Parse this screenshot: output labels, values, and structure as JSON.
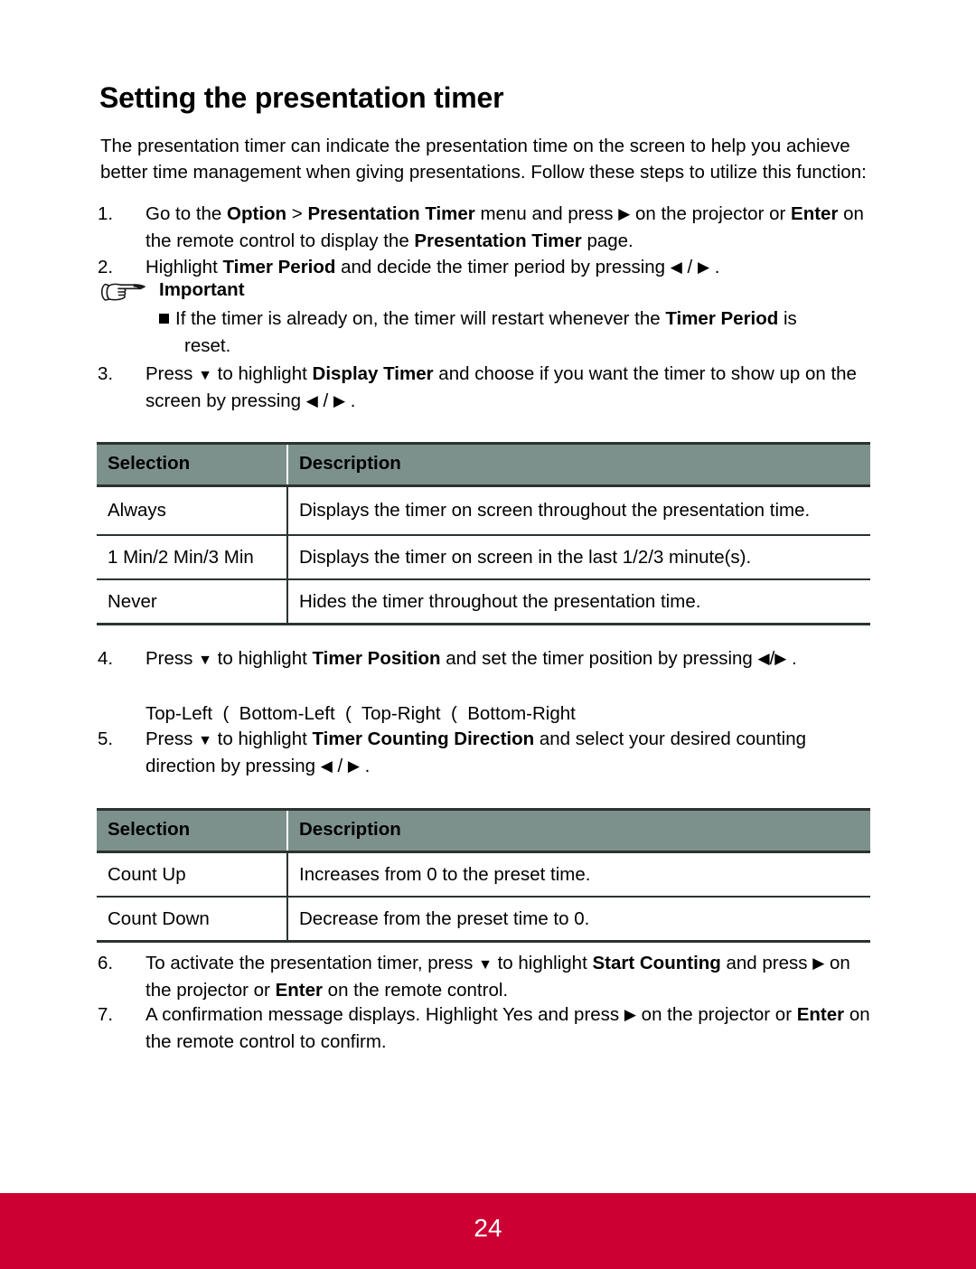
{
  "document": {
    "title": "Setting the presentation timer",
    "intro": "The presentation timer can indicate the presentation time on the screen to help you achieve better time management when giving presentations. Follow these steps to utilize this function:"
  },
  "glyphs": {
    "right_triangle": "▶",
    "left_triangle": "◀",
    "down_triangle": "▼",
    "separator": "/",
    "position_separator": "("
  },
  "steps": {
    "step1": {
      "number": "1.",
      "p1": "Go to the ",
      "b1": "Option",
      "p2": " > ",
      "b2": "Presentation Timer",
      "p3": " menu and press ",
      "arrow": "▶",
      "p4": " on the projector or ",
      "b3": "Enter",
      "p5": " on the remote control to display the ",
      "b4": "Presentation Timer",
      "p6": " page."
    },
    "step2": {
      "number": "2.",
      "p1": "Highlight ",
      "b1": "Timer Period",
      "p2": " and decide the timer period by pressing ",
      "left": "◀",
      "slash": " / ",
      "right": "▶",
      "p3": " ."
    },
    "step3": {
      "number": "3.",
      "p1": "Press ",
      "down": "▼",
      "p2": " to highlight ",
      "b1": "Display Timer",
      "p3": " and choose if you want the timer to show up on the screen by pressing ",
      "left": "◀",
      "slash": " / ",
      "right": "▶",
      "p4": " ."
    },
    "step4": {
      "number": "4.",
      "p1": "Press ",
      "down": "▼",
      "p2": " to highlight ",
      "b1": "Timer Position",
      "p3": " and set the timer position by pressing ",
      "left": "◀",
      "slash": "/",
      "right": "▶",
      "p4": " ."
    },
    "step5": {
      "number": "5.",
      "p1": "Press ",
      "down": "▼",
      "p2": " to highlight ",
      "b1": "Timer Counting Direction",
      "p3": " and select your desired counting direction by pressing ",
      "left": "◀",
      "slash": " / ",
      "right": "▶",
      "p4": " ."
    },
    "step6": {
      "number": "6.",
      "p1": "To activate the presentation timer, press ",
      "down": "▼",
      "p2": " to highlight ",
      "b1": "Start Counting",
      "p3": " and press ",
      "right": "▶",
      "p4": " on the projector or ",
      "b2": "Enter",
      "p5": " on the remote control."
    },
    "step7": {
      "number": "7.",
      "p1": "A confirmation message displays. Highlight Yes and press ",
      "right": "▶",
      "p2": " on the projector or ",
      "b1": "Enter",
      "p3": " on the remote control to confirm."
    }
  },
  "important": {
    "label": "Important",
    "bullet_part1": "If the timer is already on, the timer will restart whenever the ",
    "bullet_bold": "Timer Period",
    "bullet_part2": " is",
    "bullet_line2": "reset."
  },
  "timer_position_options": {
    "line": "Top-Left  (  Bottom-Left  (  Top-Right  (  Bottom-Right",
    "options": [
      "Top-Left",
      "Bottom-Left",
      "Top-Right",
      "Bottom-Right"
    ]
  },
  "table_display_timer": {
    "headers": [
      "Selection",
      "Description"
    ],
    "rows": [
      [
        "Always",
        "Displays the timer on screen throughout the presentation time."
      ],
      [
        "1 Min/2 Min/3 Min",
        "Displays the timer on screen in the last 1/2/3 minute(s)."
      ],
      [
        "Never",
        "Hides the timer throughout the presentation time."
      ]
    ]
  },
  "table_counting_direction": {
    "headers": [
      "Selection",
      "Description"
    ],
    "rows": [
      [
        "Count Up",
        "Increases from 0 to the preset time."
      ],
      [
        "Count Down",
        "Decrease from the preset time to 0."
      ]
    ]
  },
  "footer": {
    "page_number": "24",
    "bar_color": "#cc0033"
  },
  "colors": {
    "table_header_bg": "#7d918c",
    "table_border": "#2a3330",
    "footer_red": "#cc0033",
    "text": "#000000"
  }
}
